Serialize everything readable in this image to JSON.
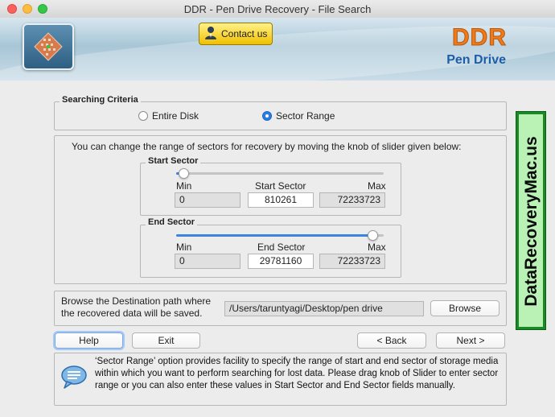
{
  "window": {
    "title": "DDR - Pen Drive Recovery - File Search"
  },
  "banner": {
    "contact_label": "Contact us",
    "brand": "DDR",
    "product": "Pen Drive"
  },
  "criteria": {
    "label": "Searching Criteria",
    "options": [
      {
        "label": "Entire Disk",
        "selected": false
      },
      {
        "label": "Sector Range",
        "selected": true
      }
    ]
  },
  "range": {
    "instruction": "You can change the range of sectors for recovery by moving the knob of slider given below:",
    "start": {
      "label": "Start Sector",
      "min_label": "Min",
      "value_label": "Start Sector",
      "max_label": "Max",
      "min": "0",
      "value": "810261",
      "max": "72233723",
      "slider_fraction": 0.011
    },
    "end": {
      "label": "End Sector",
      "min_label": "Min",
      "value_label": "End Sector",
      "max_label": "Max",
      "min": "0",
      "value": "29781160",
      "max": "72233723",
      "slider_fraction": 0.97
    }
  },
  "destination": {
    "label_line1": "Browse the Destination path where",
    "label_line2": "the recovered data will be saved.",
    "path": "/Users/taruntyagi/Desktop/pen drive",
    "browse_label": "Browse"
  },
  "buttons": {
    "help": "Help",
    "exit": "Exit",
    "back": "< Back",
    "next": "Next >"
  },
  "info": {
    "text": "‘Sector Range’ option provides facility to specify the range of start and end sector of storage media within which you want to perform searching for lost data. Please drag knob of Slider to enter sector range or you can also enter these values in Start Sector and End Sector fields manually."
  },
  "watermark": {
    "text": "DataRecoveryMac.us"
  },
  "icons": [
    "close-icon",
    "minimize-icon",
    "maximize-icon",
    "app-logo-icon",
    "contact-person-icon",
    "info-chat-icon"
  ],
  "colors": {
    "accent": "#2b7de1",
    "brand_orange": "#ef7a1a",
    "brand_blue": "#1c5da8",
    "watermark_green": "#1a8a27"
  }
}
